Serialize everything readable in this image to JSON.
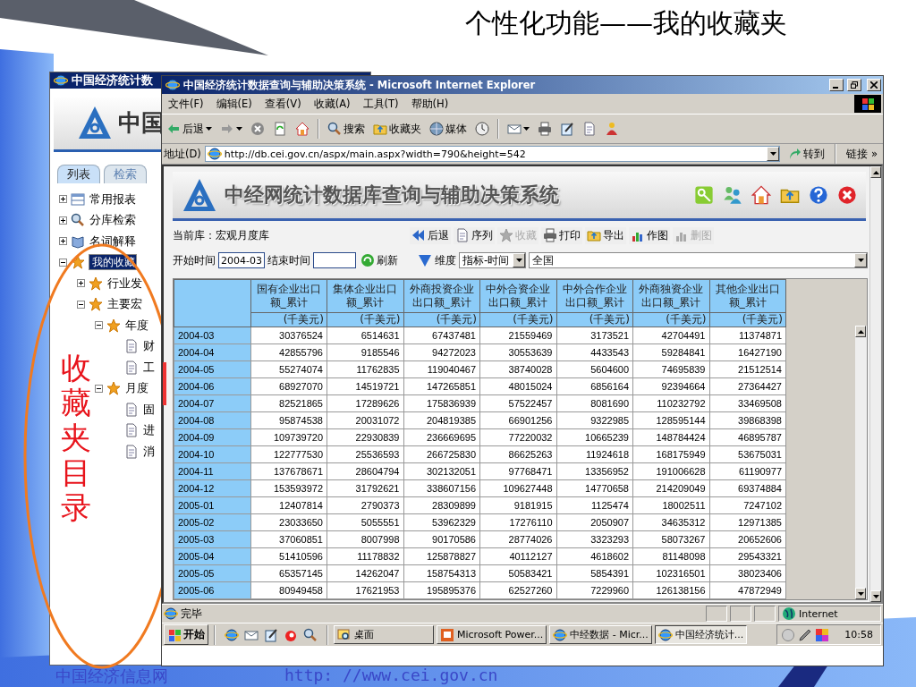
{
  "slide": {
    "title": "个性化功能——我的收藏夹",
    "callout": "收藏夹目录",
    "footer_left": "中国经济信息网",
    "footer_right": "http: //www.cei.gov.cn"
  },
  "back_window": {
    "title": "中国经济统计数",
    "logo_text": "中国",
    "tabs": [
      {
        "label": "列表",
        "selected": true
      },
      {
        "label": "检索",
        "selected": false
      }
    ],
    "tree": [
      {
        "label": "常用报表",
        "kind": "report",
        "expanded": false,
        "selected": false
      },
      {
        "label": "分库检索",
        "kind": "search",
        "expanded": false,
        "selected": false
      },
      {
        "label": "名词解释",
        "kind": "glossary",
        "expanded": false,
        "selected": false
      },
      {
        "label": "我的收藏",
        "kind": "star",
        "expanded": true,
        "selected": true,
        "children": [
          {
            "label": "行业发",
            "kind": "star",
            "expanded": false,
            "selected": false
          },
          {
            "label": "主要宏",
            "kind": "star",
            "expanded": true,
            "selected": false,
            "children": [
              {
                "label": "年度",
                "kind": "star",
                "expanded": true,
                "selected": false,
                "children": [
                  {
                    "label": "财",
                    "kind": "doc",
                    "selected": false
                  },
                  {
                    "label": "工",
                    "kind": "doc",
                    "selected": false
                  }
                ]
              },
              {
                "label": "月度",
                "kind": "star",
                "expanded": true,
                "selected": false,
                "children": [
                  {
                    "label": "固",
                    "kind": "doc",
                    "selected": false
                  },
                  {
                    "label": "进",
                    "kind": "doc",
                    "selected": false
                  },
                  {
                    "label": "消",
                    "kind": "doc",
                    "selected": false
                  }
                ]
              }
            ]
          }
        ]
      }
    ]
  },
  "browser": {
    "title": "中国经济统计数据查询与辅助决策系统 - Microsoft Internet Explorer",
    "menu": [
      "文件(F)",
      "编辑(E)",
      "查看(V)",
      "收藏(A)",
      "工具(T)",
      "帮助(H)"
    ],
    "toolbar": [
      {
        "kind": "back",
        "label": "后退"
      },
      {
        "kind": "forward"
      },
      {
        "kind": "stop"
      },
      {
        "kind": "refresh"
      },
      {
        "kind": "home"
      },
      {
        "kind": "search",
        "label": "搜索"
      },
      {
        "kind": "favorites",
        "label": "收藏夹"
      },
      {
        "kind": "media",
        "label": "媒体"
      },
      {
        "kind": "history"
      },
      {
        "kind": "mail"
      },
      {
        "kind": "print"
      },
      {
        "kind": "edit"
      },
      {
        "kind": "discuss"
      },
      {
        "kind": "messenger"
      }
    ],
    "address_label": "地址(D)",
    "address": "http://db.cei.gov.cn/aspx/main.aspx?width=790&height=542",
    "go": "转到",
    "links": "链接",
    "links_more": "»"
  },
  "page": {
    "title": "中经网统计数据库查询与辅助决策系统",
    "header_icons": [
      {
        "kind": "key"
      },
      {
        "kind": "users"
      },
      {
        "kind": "home"
      },
      {
        "kind": "swap"
      },
      {
        "kind": "help"
      },
      {
        "kind": "close"
      }
    ],
    "database_label": "当前库：宏观月度库",
    "actions": [
      {
        "kind": "back",
        "label": "后退",
        "disabled": false
      },
      {
        "kind": "series",
        "label": "序列",
        "disabled": false
      },
      {
        "kind": "favorite",
        "label": "收藏",
        "disabled": true
      },
      {
        "kind": "print",
        "label": "打印",
        "disabled": false
      },
      {
        "kind": "export",
        "label": "导出",
        "disabled": false
      },
      {
        "kind": "chart",
        "label": "作图",
        "disabled": false
      },
      {
        "kind": "delete-chart",
        "label": "删图",
        "disabled": true
      }
    ],
    "start_label": "开始时间",
    "start_value": "2004-03",
    "end_label": "结束时间",
    "refresh": "刷新",
    "dimension_label": "维度",
    "dimension_value": "指标-时间",
    "region_value": "全国",
    "table": {
      "columns": [
        {
          "title": "国有企业出口额_累计",
          "unit": "(千美元)"
        },
        {
          "title": "集体企业出口额_累计",
          "unit": "(千美元)"
        },
        {
          "title": "外商投资企业出口额_累计",
          "unit": "(千美元)"
        },
        {
          "title": "中外合资企业出口额_累计",
          "unit": "(千美元)"
        },
        {
          "title": "中外合作企业出口额_累计",
          "unit": "(千美元)"
        },
        {
          "title": "外商独资企业出口额_累计",
          "unit": "(千美元)"
        },
        {
          "title": "其他企业出口额_累计",
          "unit": "(千美元)"
        }
      ],
      "rows": [
        {
          "period": "2004-03",
          "values": [
            "30376524",
            "6514631",
            "67437481",
            "21559469",
            "3173521",
            "42704491",
            "11374871"
          ]
        },
        {
          "period": "2004-04",
          "values": [
            "42855796",
            "9185546",
            "94272023",
            "30553639",
            "4433543",
            "59284841",
            "16427190"
          ]
        },
        {
          "period": "2004-05",
          "values": [
            "55274074",
            "11762835",
            "119040467",
            "38740028",
            "5604600",
            "74695839",
            "21512514"
          ]
        },
        {
          "period": "2004-06",
          "values": [
            "68927070",
            "14519721",
            "147265851",
            "48015024",
            "6856164",
            "92394664",
            "27364427"
          ]
        },
        {
          "period": "2004-07",
          "values": [
            "82521865",
            "17289626",
            "175836939",
            "57522457",
            "8081690",
            "110232792",
            "33469508"
          ]
        },
        {
          "period": "2004-08",
          "values": [
            "95874538",
            "20031072",
            "204819385",
            "66901256",
            "9322985",
            "128595144",
            "39868398"
          ]
        },
        {
          "period": "2004-09",
          "values": [
            "109739720",
            "22930839",
            "236669695",
            "77220032",
            "10665239",
            "148784424",
            "46895787"
          ]
        },
        {
          "period": "2004-10",
          "values": [
            "122777530",
            "25536593",
            "266725830",
            "86625263",
            "11924618",
            "168175949",
            "53675031"
          ]
        },
        {
          "period": "2004-11",
          "values": [
            "137678671",
            "28604794",
            "302132051",
            "97768471",
            "13356952",
            "191006628",
            "61190977"
          ]
        },
        {
          "period": "2004-12",
          "values": [
            "153593972",
            "31792621",
            "338607156",
            "109627448",
            "14770658",
            "214209049",
            "69374884"
          ]
        },
        {
          "period": "2005-01",
          "values": [
            "12407814",
            "2790373",
            "28309899",
            "9181915",
            "1125474",
            "18002511",
            "7247102"
          ]
        },
        {
          "period": "2005-02",
          "values": [
            "23033650",
            "5055551",
            "53962329",
            "17276110",
            "2050907",
            "34635312",
            "12971385"
          ]
        },
        {
          "period": "2005-03",
          "values": [
            "37060851",
            "8007998",
            "90170586",
            "28774026",
            "3323293",
            "58073267",
            "20652606"
          ]
        },
        {
          "period": "2005-04",
          "values": [
            "51410596",
            "11178832",
            "125878827",
            "40112127",
            "4618602",
            "81148098",
            "29543321"
          ]
        },
        {
          "period": "2005-05",
          "values": [
            "65357145",
            "14262047",
            "158754313",
            "50583421",
            "5854391",
            "102316501",
            "38023406"
          ]
        },
        {
          "period": "2005-06",
          "values": [
            "80949458",
            "17621953",
            "195895376",
            "62527260",
            "7229960",
            "126138156",
            "47872949"
          ]
        }
      ]
    }
  },
  "status_bar": {
    "text": "完毕",
    "zone": "Internet"
  },
  "taskbar": {
    "start": "开始",
    "quick_launch": [
      {
        "kind": "browser"
      },
      {
        "kind": "mail"
      },
      {
        "kind": "notepad"
      },
      {
        "kind": "swirl"
      },
      {
        "kind": "magnifier"
      }
    ],
    "tasks": [
      {
        "kind": "desktop",
        "label": "桌面",
        "selected": false
      },
      {
        "kind": "slides",
        "label": "Microsoft Power...",
        "selected": false
      },
      {
        "kind": "browser",
        "label": "中经数据 - Micr...",
        "selected": false
      },
      {
        "kind": "browser",
        "label": "中国经济统计...",
        "selected": true
      }
    ],
    "clock": "10:58"
  }
}
